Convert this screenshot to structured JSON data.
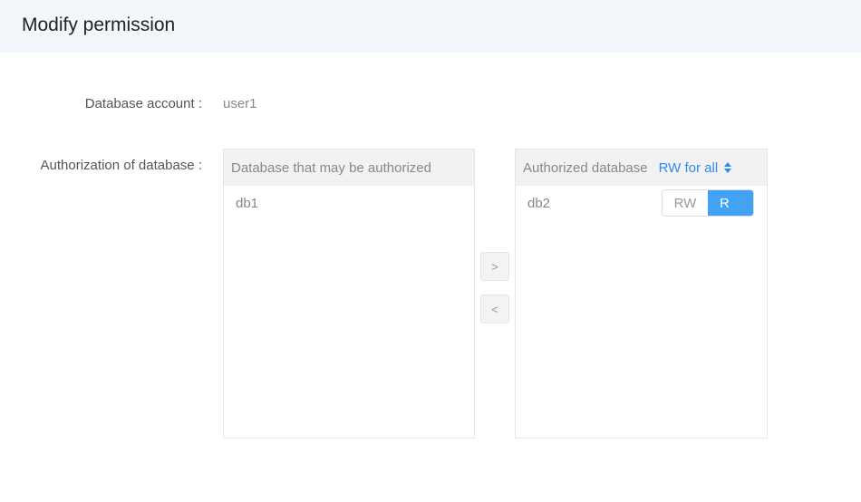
{
  "header": {
    "title": "Modify permission"
  },
  "form": {
    "account_label": "Database account :",
    "account_value": "user1",
    "auth_label": "Authorization of database :"
  },
  "left_panel": {
    "title": "Database that may be authorized",
    "items": [
      "db1"
    ]
  },
  "right_panel": {
    "title": "Authorized database",
    "rw_all_label": "RW for all",
    "items": [
      {
        "name": "db2",
        "options": [
          "RW",
          "R"
        ],
        "selected": "R"
      }
    ]
  },
  "transfer": {
    "to_right_label": ">",
    "to_left_label": "<"
  },
  "colors": {
    "accent": "#2d8cf0",
    "toggle_selected": "#41a3f5",
    "header_bg": "#f3f6fa"
  }
}
